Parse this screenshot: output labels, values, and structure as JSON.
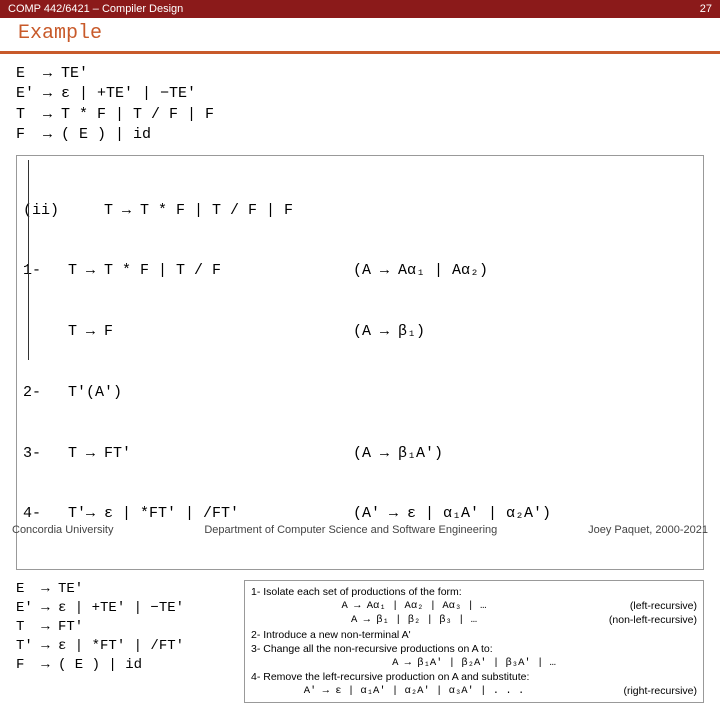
{
  "header": {
    "course": "COMP 442/6421 – Compiler Design",
    "page_no": "27"
  },
  "title": "Example",
  "grammar_top": "E  → TE'\nE' → ε | +TE' | −TE'\nT  → T * F | T / F | F\nF  → ( E ) | id",
  "ii": {
    "label": "(ii)",
    "rows": [
      {
        "left": "     T → T * F | T / F | F",
        "right": ""
      },
      {
        "left": "1-   T → T * F | T / F",
        "right": "(A → Aα₁ | Aα₂)"
      },
      {
        "left": "     T → F",
        "right": "(A → β₁)"
      },
      {
        "left": "2-   T'(A')",
        "right": ""
      },
      {
        "left": "3-   T → FT'",
        "right": "(A → β₁A')"
      },
      {
        "left": "4-   T'→ ε | *FT' | /FT'",
        "right": "(A' → ε | α₁A' | α₂A')"
      }
    ]
  },
  "grammar_bottom": "E  → TE'\nE' → ε | +TE' | −TE'\nT  → FT'\nT' → ε | *FT' | /FT'\nF  → ( E ) | id",
  "rules": {
    "l1": "1- Isolate each set of productions of the form:",
    "f1": "A → Aα₁ | Aα₂ | Aα₃ | …",
    "t1": "(left-recursive)",
    "f2": "A → β₁ | β₂ | β₃ | …",
    "t2": "(non-left-recursive)",
    "l2": "2- Introduce a new non-terminal A'",
    "l3": "3- Change all the non-recursive productions on A to:",
    "f3": "A → β₁A' | β₂A' | β₃A' | …",
    "l4": "4- Remove the left-recursive production on A and substitute:",
    "f4": "A' → ε | α₁A' | α₂A' | α₃A' | . . .",
    "t4": "(right-recursive)"
  },
  "footer": {
    "left": "Concordia University",
    "center": "Department of Computer Science and Software Engineering",
    "right": "Joey Paquet, 2000-2021"
  }
}
